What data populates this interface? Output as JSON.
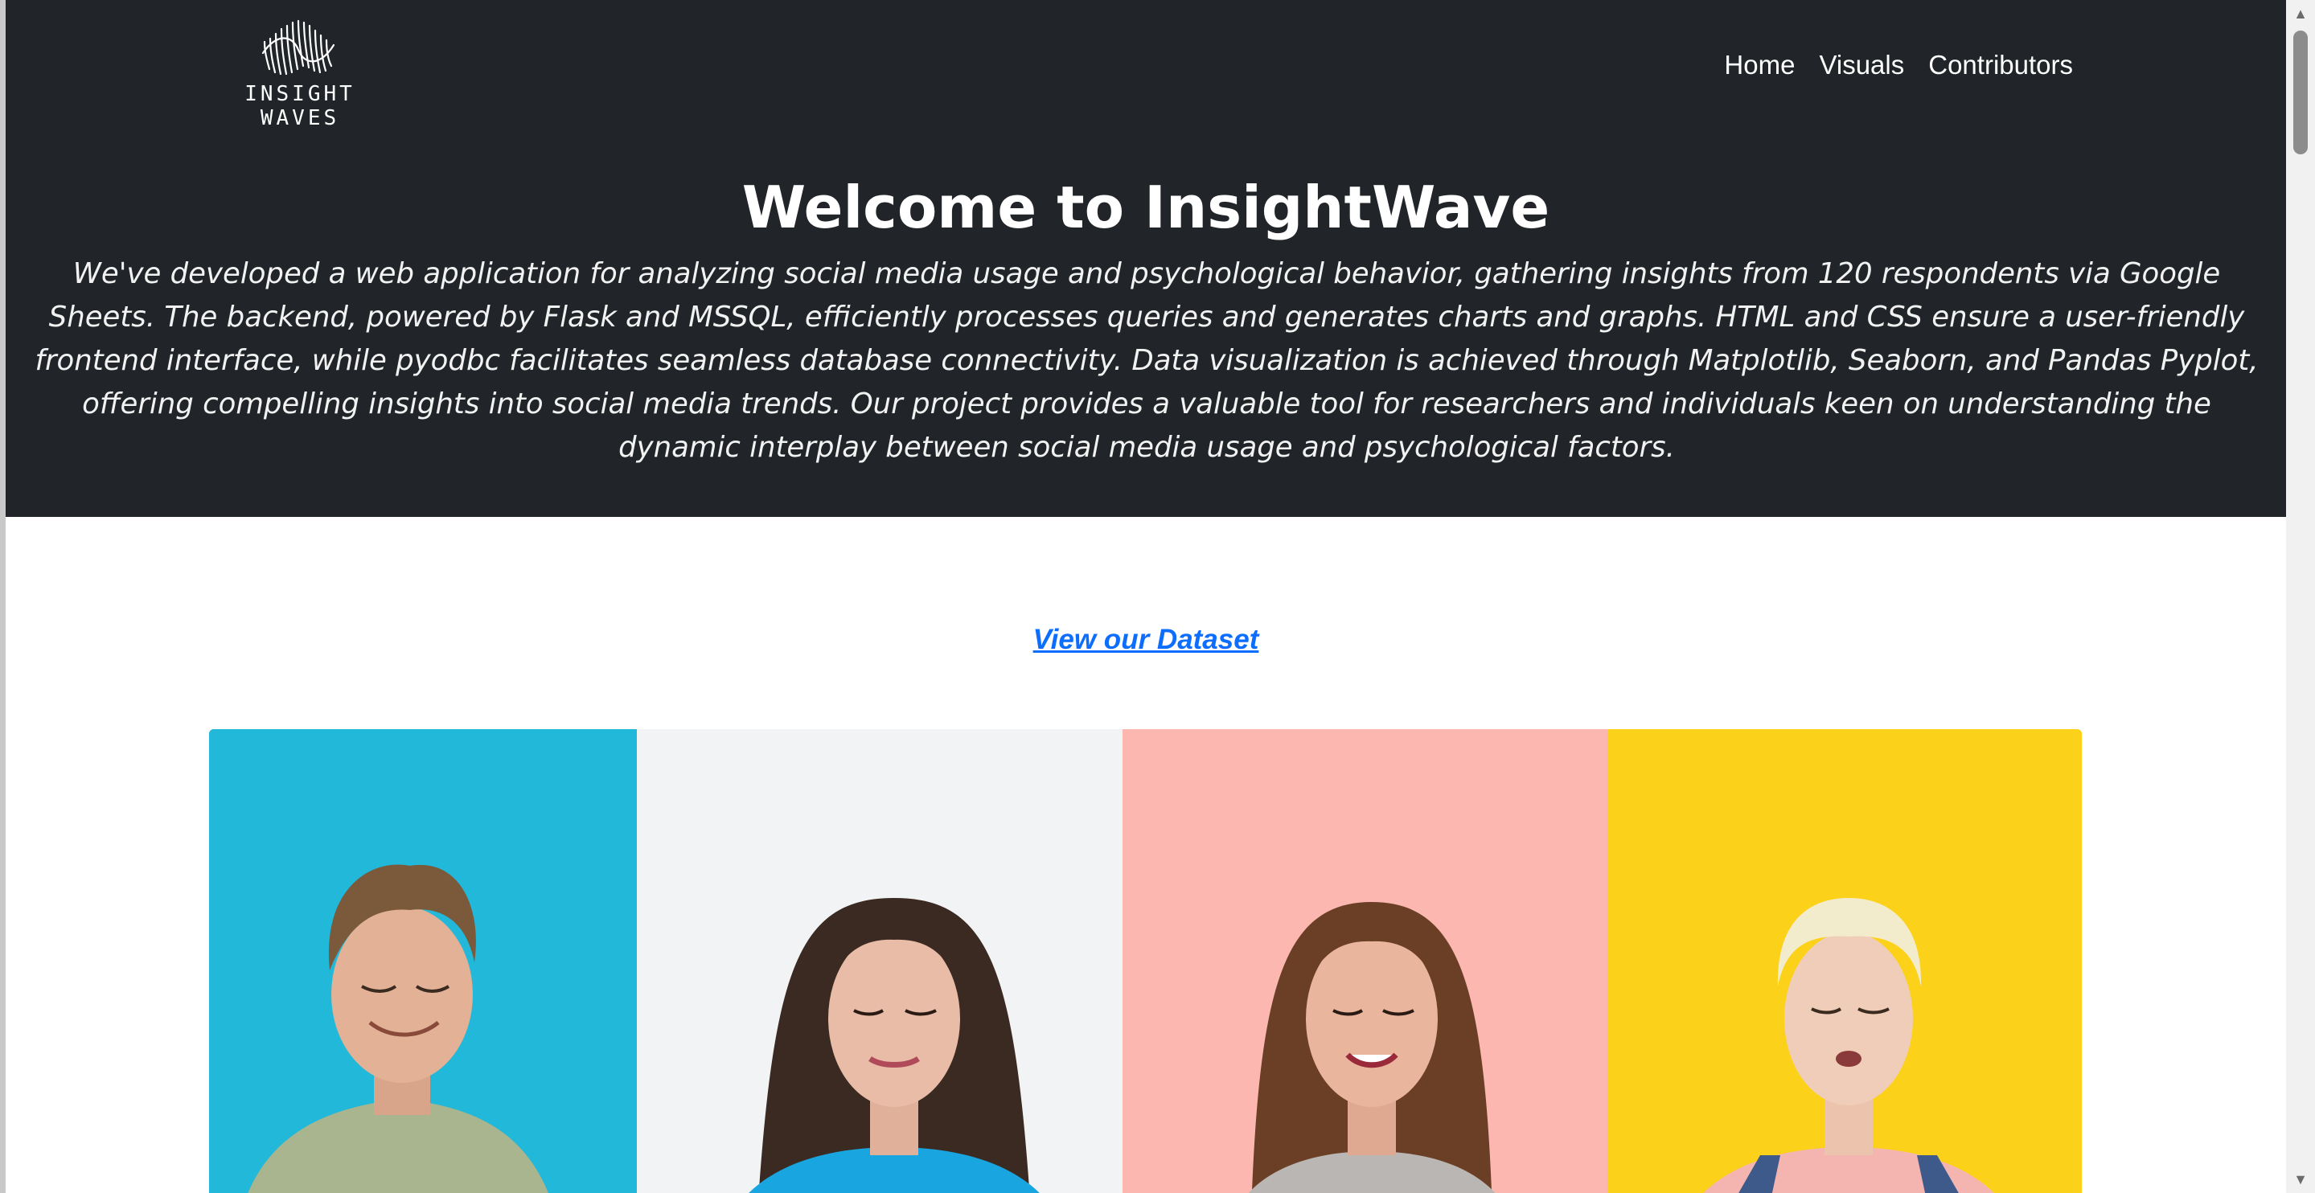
{
  "header": {
    "logo_text": "INSIGHT WAVES",
    "nav": [
      {
        "label": "Home"
      },
      {
        "label": "Visuals"
      },
      {
        "label": "Contributors"
      }
    ]
  },
  "hero": {
    "title": "Welcome to InsightWave",
    "description": "We've developed a web application for analyzing social media usage and psychological behavior, gathering insights from 120 respondents via Google Sheets. The backend, powered by Flask and MSSQL, efficiently processes queries and generates charts and graphs. HTML and CSS ensure a user-friendly frontend interface, while pyodbc facilitates seamless database connectivity. Data visualization is achieved through Matplotlib, Seaborn, and Pandas Pyplot, offering compelling insights into social media trends. Our project provides a valuable tool for researchers and individuals keen on understanding the dynamic interplay between social media usage and psychological factors."
  },
  "dataset_link": {
    "label": "View our Dataset"
  },
  "banner": {
    "panels": [
      {
        "bg": "#13b3d6",
        "person": "man-short-hair"
      },
      {
        "bg": "#f2f3f5",
        "person": "woman-dark-hair"
      },
      {
        "bg": "#fcb8b0",
        "person": "woman-brown-hair"
      },
      {
        "bg": "#fcd11a",
        "person": "woman-blonde-short-hair"
      }
    ]
  },
  "colors": {
    "header_bg": "#212529",
    "link": "#0d6efd",
    "page_bg": "#ffffff"
  },
  "icons": {
    "scroll_up": "▲",
    "scroll_down": "▼"
  }
}
